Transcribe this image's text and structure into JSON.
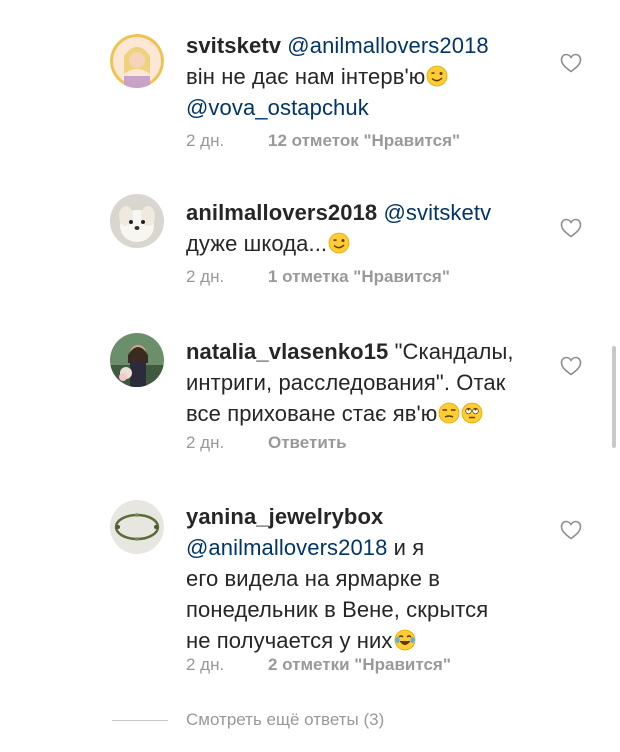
{
  "comments": [
    {
      "username": "svitsketv",
      "mention": "@anilmallovers2018",
      "line2": "він не дає нам інтерв'ю",
      "mention2": "@vova_ostapchuk",
      "time": "2 дн.",
      "likes": "12 отметок \"Нравится\""
    },
    {
      "username": "anilmallovers2018",
      "mention": "@svitsketv",
      "text": "дуже шкода...",
      "time": "2 дн.",
      "likes": "1 отметка \"Нравится\""
    },
    {
      "username": "natalia_vlasenko15",
      "text1": " \"Скандалы,",
      "text2": "интриги, расследования\". Отак",
      "text3": "все приховане стає яв'ю",
      "time": "2 дн.",
      "reply": "Ответить"
    },
    {
      "username": "yanina_jewelrybox",
      "mention": "@anilmallovers2018",
      "text1": " и я",
      "text2": "его видела на ярмарке в",
      "text3": "понедельник в Вене, скрытся",
      "text4": "не получается у них",
      "time": "2 дн.",
      "likes": "2 отметки \"Нравится\""
    }
  ],
  "view_more": "Смотреть ещё ответы (3)",
  "icons": {
    "like": "heart-outline-icon",
    "wink": "winking-face-emoji",
    "unamused": "unamused-face-emoji",
    "eye_roll": "face-with-rolling-eyes-emoji",
    "laugh": "face-with-tears-of-joy-emoji"
  },
  "colors": {
    "text": "#262626",
    "mention": "#003569",
    "meta": "#999999"
  }
}
